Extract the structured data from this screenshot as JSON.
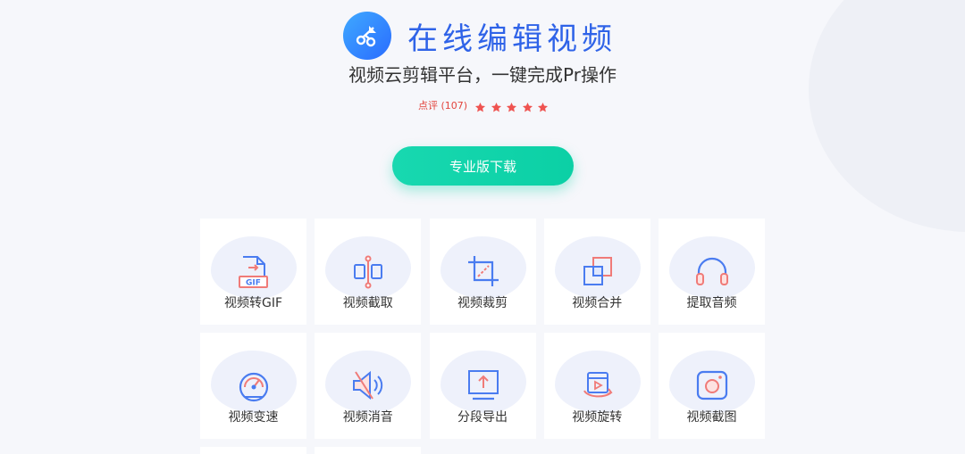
{
  "header": {
    "title": "在线编辑视频",
    "subtitle": "视频云剪辑平台，一键完成Pr操作",
    "review_label": "点评 (107)",
    "rating": 5,
    "rating_max": 5
  },
  "download_button": {
    "label": "专业版下载"
  },
  "tools": [
    {
      "label": "视频转GIF",
      "icon": "gif-convert-icon"
    },
    {
      "label": "视频截取",
      "icon": "video-trim-icon"
    },
    {
      "label": "视频裁剪",
      "icon": "crop-icon"
    },
    {
      "label": "视频合并",
      "icon": "merge-icon"
    },
    {
      "label": "提取音频",
      "icon": "headphones-icon"
    },
    {
      "label": "视频变速",
      "icon": "speedometer-icon"
    },
    {
      "label": "视频消音",
      "icon": "mute-icon"
    },
    {
      "label": "分段导出",
      "icon": "export-icon"
    },
    {
      "label": "视频旋转",
      "icon": "rotate-video-icon"
    },
    {
      "label": "视频截图",
      "icon": "camera-icon"
    }
  ],
  "colors": {
    "primary_blue": "#2f63e8",
    "accent_green": "#10d4aa",
    "accent_red": "#e2443d",
    "icon_blue": "#4a7cf0",
    "icon_red": "#f07b78"
  }
}
